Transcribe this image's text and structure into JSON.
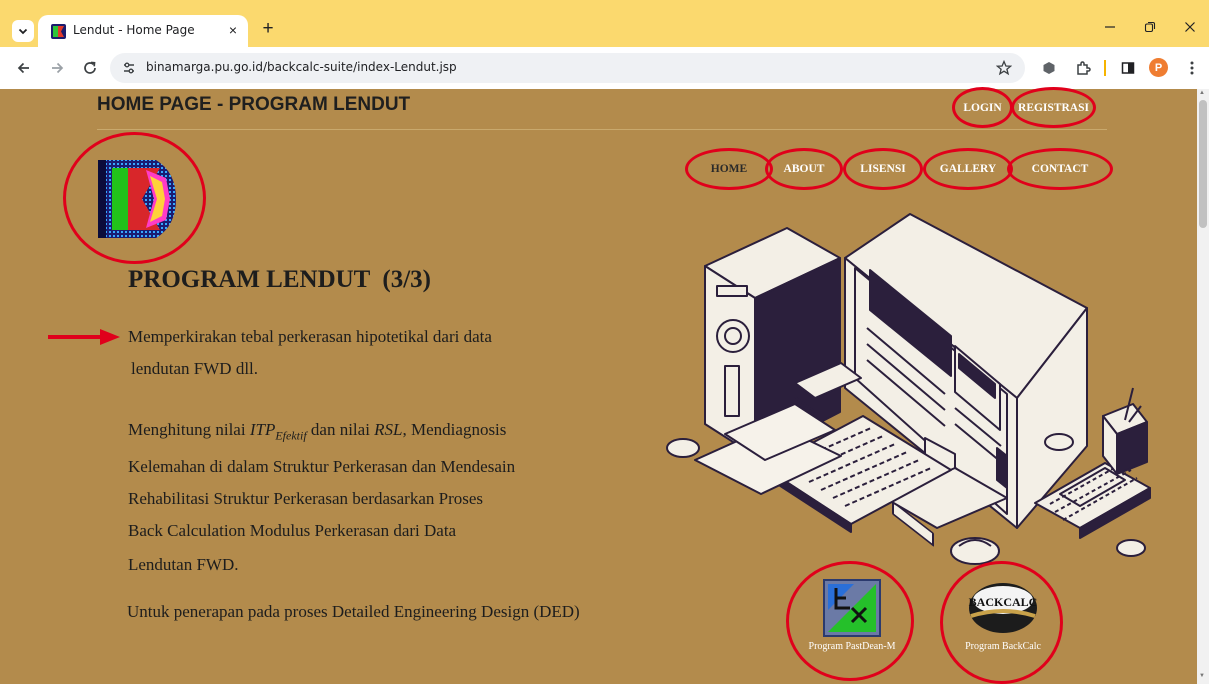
{
  "browser": {
    "tab_title": "Lendut - Home Page",
    "tab_close": "×",
    "new_tab": "+",
    "url": "binamarga.pu.go.id/backcalc-suite/index-Lendut.jsp",
    "profile_initial": "P"
  },
  "header": {
    "title": "HOME PAGE - PROGRAM LENDUT",
    "login": "LOGIN",
    "register": "REGISTRASI"
  },
  "nav": {
    "items": [
      {
        "label": "HOME",
        "active": true
      },
      {
        "label": "ABOUT"
      },
      {
        "label": "LISENSI"
      },
      {
        "label": "GALLERY"
      },
      {
        "label": "CONTACT"
      }
    ]
  },
  "main": {
    "heading": "PROGRAM LENDUT  (3/3)",
    "para1_line1": "Memperkirakan tebal perkerasan hipotetikal dari data",
    "para1_line2": "lendutan FWD dll.",
    "para2_prefix": "Menghitung nilai ",
    "para2_itp": "ITP",
    "para2_sub": "Efektif",
    "para2_mid": " dan nilai ",
    "para2_rsl": "RSL",
    "para2_rest": ", Mendiagnosis",
    "para2_line2": "Kelemahan di dalam Struktur Perkerasan dan Mendesain",
    "para2_line3": "Rehabilitasi Struktur Perkerasan berdasarkan Proses",
    "para2_line4": "Back Calculation Modulus Perkerasan dari Data",
    "para2_line5": "Lendutan FWD.",
    "para3": "Untuk penerapan pada proses Detailed Engineering Design (DED)"
  },
  "programs": [
    {
      "caption": "Program PastDean-M"
    },
    {
      "caption": "Program BackCalc",
      "logo_text": "BACKCALC"
    }
  ],
  "colors": {
    "page_bg": "#b38b4c",
    "annotation_red": "#e0001b",
    "tabstrip": "#fbd96e",
    "dark_ink": "#2b1f3c"
  },
  "icons": {
    "back": "arrow-left-icon",
    "forward": "arrow-right-icon",
    "reload": "reload-icon",
    "bookmark": "star-icon",
    "extensions": "puzzle-icon",
    "side_panel": "side-panel-icon",
    "menu": "kebab-menu-icon"
  }
}
